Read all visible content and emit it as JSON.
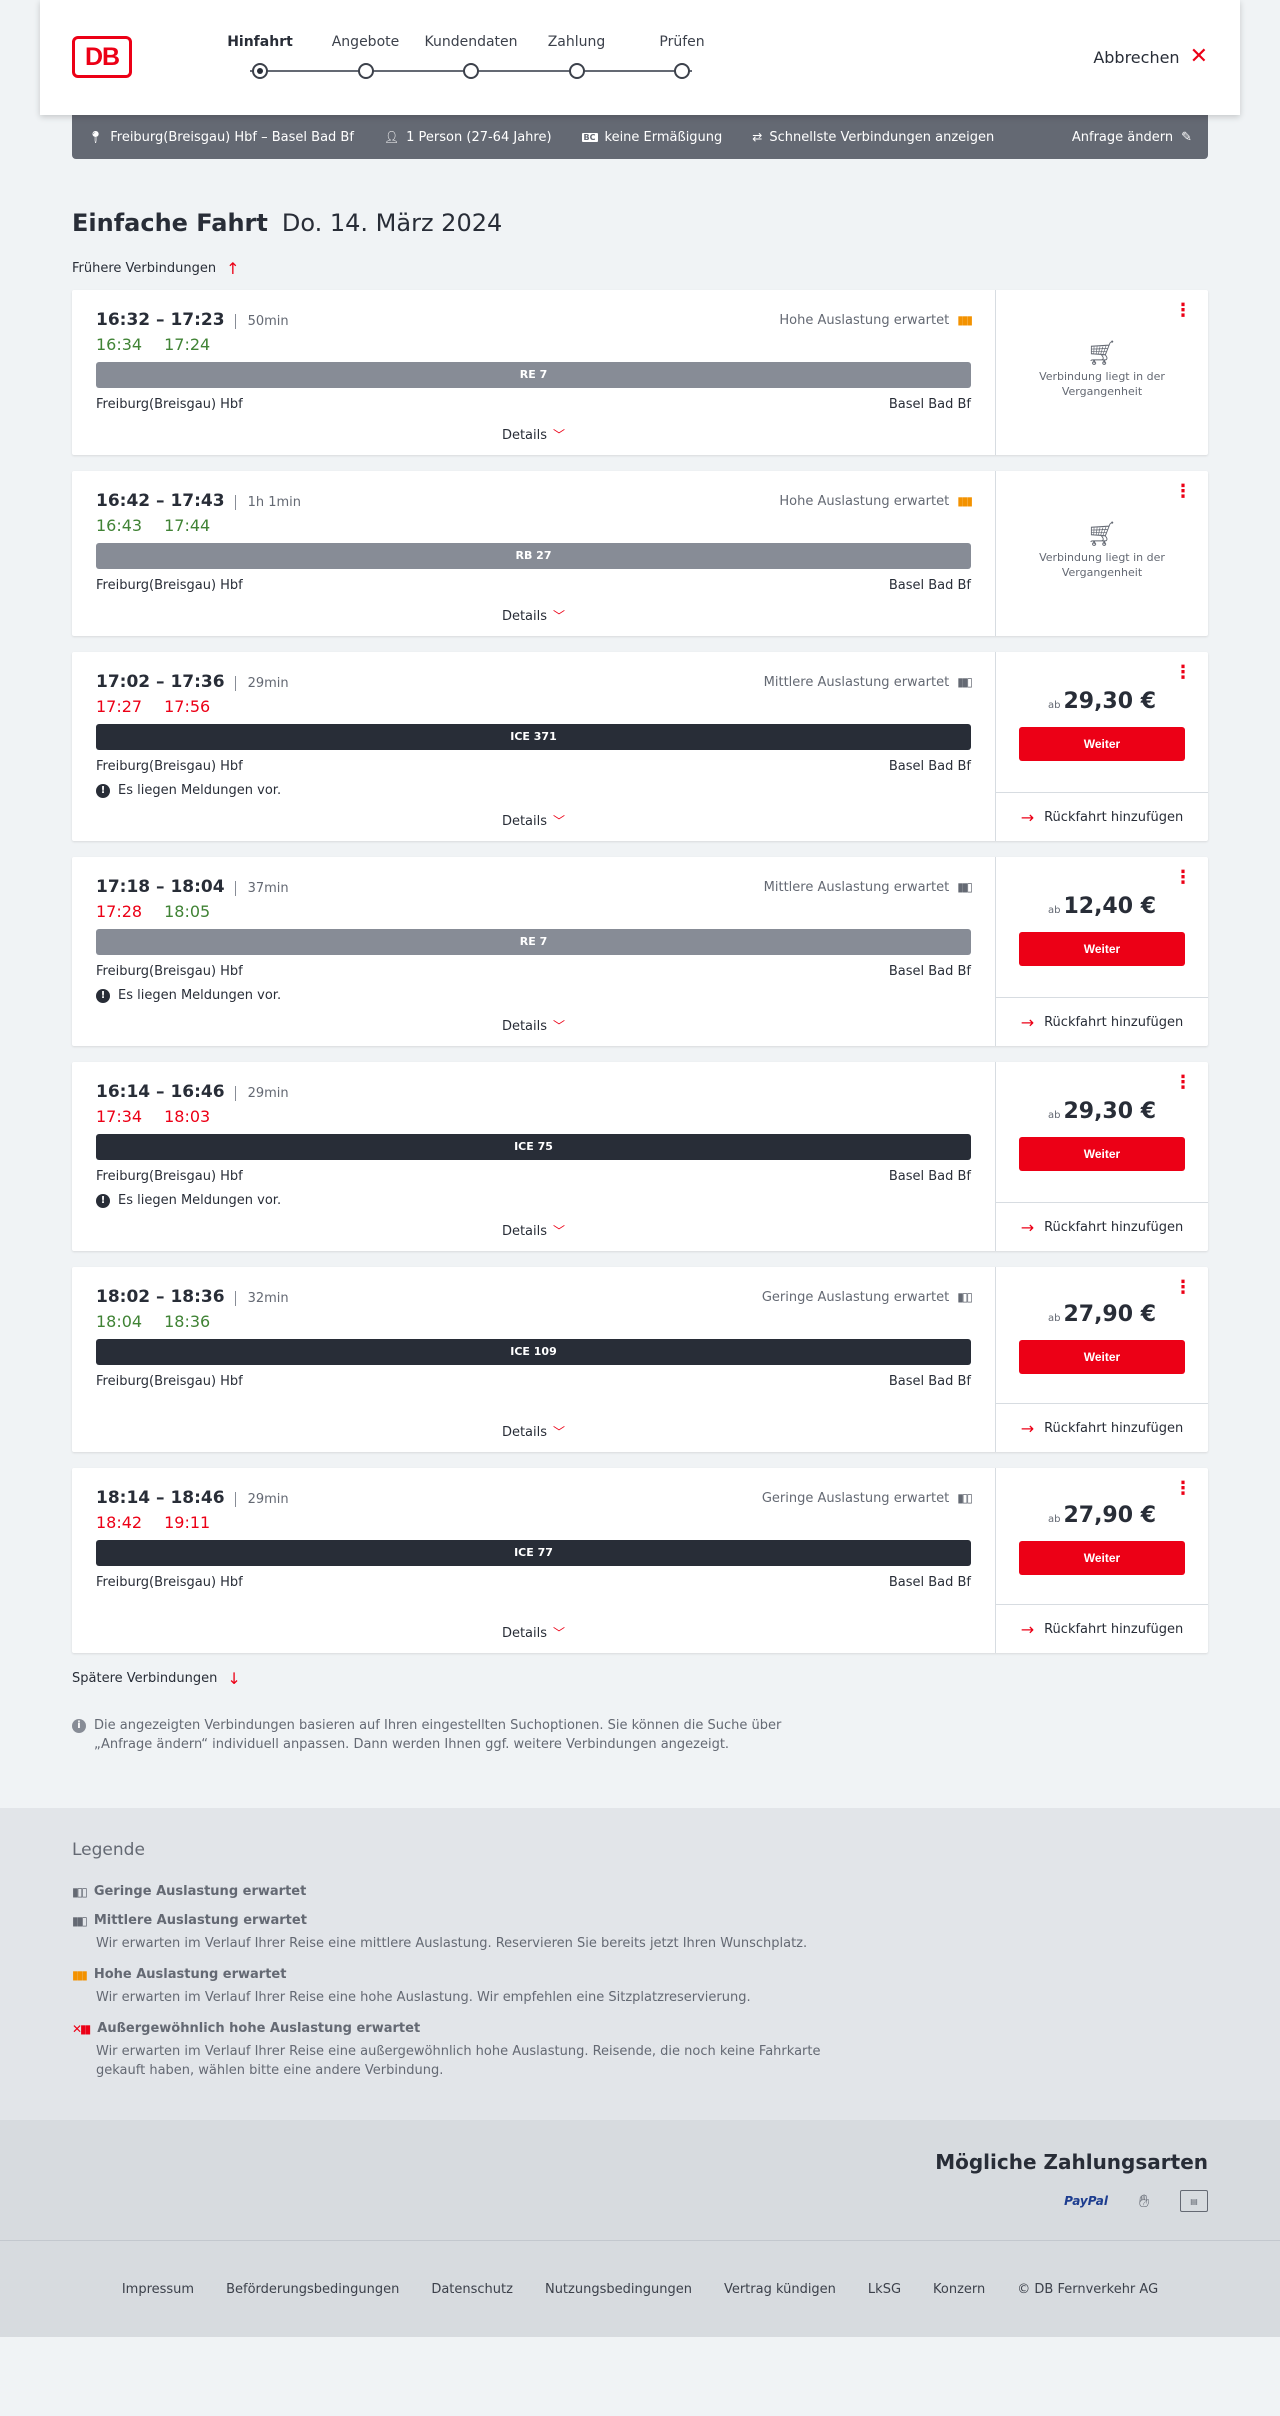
{
  "header": {
    "logo_text": "DB",
    "steps": [
      {
        "label": "Hinfahrt",
        "active": true
      },
      {
        "label": "Angebote",
        "active": false
      },
      {
        "label": "Kundendaten",
        "active": false
      },
      {
        "label": "Zahlung",
        "active": false
      },
      {
        "label": "Prüfen",
        "active": false
      }
    ],
    "cancel_label": "Abbrechen"
  },
  "searchbar": {
    "route": "Freiburg(Breisgau) Hbf – Basel Bad Bf",
    "travellers": "1 Person (27-64 Jahre)",
    "discount": "keine Ermäßigung",
    "fastest": "Schnellste Verbindungen anzeigen",
    "edit": "Anfrage ändern"
  },
  "title": {
    "bold": "Einfache Fahrt",
    "date": "Do. 14. März 2024"
  },
  "earlier": "Frühere Verbindungen",
  "later": "Spätere Verbindungen",
  "labels": {
    "details": "Details",
    "weiter": "Weiter",
    "return": "Rückfahrt hinzufügen",
    "past": "Verbindung liegt in der Vergangenheit",
    "price_prefix": "ab",
    "notice": "Es liegen Meldungen vor."
  },
  "connections": [
    {
      "times": "16:32 – 17:23",
      "duration": "50min",
      "occupancy": "Hohe Auslastung erwartet",
      "occ_level": "high",
      "rt_dep": "16:34",
      "rt_arr": "17:24",
      "dep_late": false,
      "arr_late": false,
      "train": "RE 7",
      "train_type": "regio",
      "from": "Freiburg(Breisgau) Hbf",
      "to": "Basel Bad Bf",
      "notice": false,
      "past": true,
      "price": ""
    },
    {
      "times": "16:42 – 17:43",
      "duration": "1h 1min",
      "occupancy": "Hohe Auslastung erwartet",
      "occ_level": "high",
      "rt_dep": "16:43",
      "rt_arr": "17:44",
      "dep_late": false,
      "arr_late": false,
      "train": "RB 27",
      "train_type": "regio",
      "from": "Freiburg(Breisgau) Hbf",
      "to": "Basel Bad Bf",
      "notice": false,
      "past": true,
      "price": ""
    },
    {
      "times": "17:02 – 17:36",
      "duration": "29min",
      "occupancy": "Mittlere Auslastung erwartet",
      "occ_level": "medium",
      "rt_dep": "17:27",
      "rt_arr": "17:56",
      "dep_late": true,
      "arr_late": true,
      "train": "ICE 371",
      "train_type": "ice",
      "from": "Freiburg(Breisgau) Hbf",
      "to": "Basel Bad Bf",
      "notice": true,
      "past": false,
      "price": "29,30 €"
    },
    {
      "times": "17:18 – 18:04",
      "duration": "37min",
      "occupancy": "Mittlere Auslastung erwartet",
      "occ_level": "medium",
      "rt_dep": "17:28",
      "rt_arr": "18:05",
      "dep_late": true,
      "arr_late": false,
      "train": "RE 7",
      "train_type": "regio",
      "from": "Freiburg(Breisgau) Hbf",
      "to": "Basel Bad Bf",
      "notice": true,
      "past": false,
      "price": "12,40 €"
    },
    {
      "times": "16:14 – 16:46",
      "duration": "29min",
      "occupancy": "",
      "occ_level": "",
      "rt_dep": "17:34",
      "rt_arr": "18:03",
      "dep_late": true,
      "arr_late": true,
      "train": "ICE 75",
      "train_type": "ice",
      "from": "Freiburg(Breisgau) Hbf",
      "to": "Basel Bad Bf",
      "notice": true,
      "past": false,
      "price": "29,30 €"
    },
    {
      "times": "18:02 – 18:36",
      "duration": "32min",
      "occupancy": "Geringe Auslastung erwartet",
      "occ_level": "low",
      "rt_dep": "18:04",
      "rt_arr": "18:36",
      "dep_late": false,
      "arr_late": false,
      "train": "ICE 109",
      "train_type": "ice",
      "from": "Freiburg(Breisgau) Hbf",
      "to": "Basel Bad Bf",
      "notice": false,
      "past": false,
      "price": "27,90 €"
    },
    {
      "times": "18:14 – 18:46",
      "duration": "29min",
      "occupancy": "Geringe Auslastung erwartet",
      "occ_level": "low",
      "rt_dep": "18:42",
      "rt_arr": "19:11",
      "dep_late": true,
      "arr_late": true,
      "train": "ICE 77",
      "train_type": "ice",
      "from": "Freiburg(Breisgau) Hbf",
      "to": "Basel Bad Bf",
      "notice": false,
      "past": false,
      "price": "27,90 €"
    }
  ],
  "info_text": "Die angezeigten Verbindungen basieren auf Ihren eingestellten Suchoptionen. Sie können die Suche über „Anfrage ändern“ individuell anpassen. Dann werden Ihnen ggf. weitere Verbindungen angezeigt.",
  "legend": {
    "title": "Legende",
    "items": [
      {
        "title": "Geringe Auslastung erwartet",
        "desc": "",
        "level": "low"
      },
      {
        "title": "Mittlere Auslastung erwartet",
        "desc": "Wir erwarten im Verlauf Ihrer Reise eine mittlere Auslastung. Reservieren Sie bereits jetzt Ihren Wunschplatz.",
        "level": "medium"
      },
      {
        "title": "Hohe Auslastung erwartet",
        "desc": "Wir erwarten im Verlauf Ihrer Reise eine hohe Auslastung. Wir empfehlen eine Sitzplatzreservierung.",
        "level": "high"
      },
      {
        "title": "Außergewöhnlich hohe Auslastung erwartet",
        "desc": "Wir erwarten im Verlauf Ihrer Reise eine außergewöhnlich hohe Auslastung. Reisende, die noch keine Fahrkarte gekauft haben, wählen bitte eine andere Verbindung.",
        "level": "extreme"
      }
    ]
  },
  "payments": {
    "title": "Mögliche Zahlungsarten",
    "paypal": "PayPal"
  },
  "footer": [
    "Impressum",
    "Beförderungsbedingungen",
    "Datenschutz",
    "Nutzungsbedingungen",
    "Vertrag kündigen",
    "LkSG",
    "Konzern",
    "© DB Fernverkehr AG"
  ],
  "colors": {
    "accent": "#ec0016",
    "ontime": "#408335",
    "high_occupancy": "#f39200",
    "regio_bar": "#878c96",
    "ice_bar": "#282d37"
  }
}
